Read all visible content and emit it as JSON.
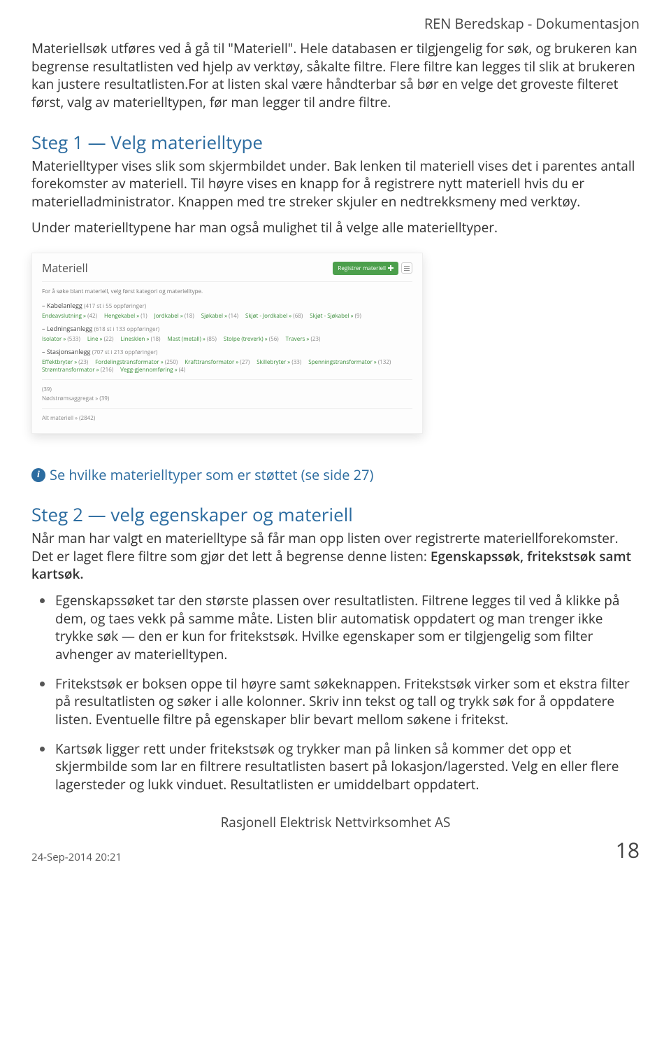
{
  "doc_header": "REN Beredskap - Dokumentasjon",
  "intro": "Materiellsøk utføres ved å gå til \"Materiell\". Hele databasen er tilgjengelig for søk, og brukeren kan begrense resultatlisten ved hjelp av verktøy, såkalte filtre. Flere filtre kan legges til slik at brukeren kan justere resultatlisten.For at listen skal være håndterbar så bør en velge det groveste filteret først, valg av materielltypen, før man legger til andre filtre.",
  "step1": {
    "title": "Steg 1 — Velg materielltype",
    "text1": "Materielltyper vises slik som skjermbildet under. Bak lenken til materiell vises det i parentes antall forekomster av materiell. Til høyre vises en knapp for å registrere nytt materiell hvis du er materielladministrator. Knappen med tre streker skjuler en nedtrekksmeny med verktøy.",
    "text2": "Under materielltypene har man også mulighet til å velge alle materielltyper."
  },
  "mock": {
    "title": "Materiell",
    "register_btn": "Registrer materiell",
    "instruction": "For å søke blant materiell, velg først kategori og materielltype.",
    "cat1": {
      "prefix": "–",
      "name": "Kabelanlegg",
      "meta": "(417 st i 55 oppføringer)",
      "subs": [
        {
          "t": "Endeavslutning »",
          "c": "(42)"
        },
        {
          "t": "Hengekabel »",
          "c": "(1)"
        },
        {
          "t": "Jordkabel »",
          "c": "(18)"
        },
        {
          "t": "Sjøkabel »",
          "c": "(14)"
        },
        {
          "t": "Skjøt - Jordkabel »",
          "c": "(68)"
        },
        {
          "t": "Skjøt - Sjøkabel »",
          "c": "(9)"
        }
      ]
    },
    "cat2": {
      "prefix": "–",
      "name": "Ledningsanlegg",
      "meta": "(618 st i 133 oppføringer)",
      "subs": [
        {
          "t": "Isolator »",
          "c": "(533)"
        },
        {
          "t": "Line »",
          "c": "(22)"
        },
        {
          "t": "Linesklen »",
          "c": "(18)"
        },
        {
          "t": "Mast (metall) »",
          "c": "(85)"
        },
        {
          "t": "Stolpe (treverk) »",
          "c": "(56)"
        },
        {
          "t": "Travers »",
          "c": "(23)"
        }
      ]
    },
    "cat3": {
      "prefix": "–",
      "name": "Stasjonsanlegg",
      "meta": "(707 st i 213 oppføringer)",
      "subs": [
        {
          "t": "Effektbryter »",
          "c": "(23)"
        },
        {
          "t": "Fordelingstransformator »",
          "c": "(250)"
        },
        {
          "t": "Krafttransformator »",
          "c": "(27)"
        },
        {
          "t": "Skillebryter »",
          "c": "(33)"
        },
        {
          "t": "Spenningstransformator »",
          "c": "(132)"
        },
        {
          "t": "Strømtransformator »",
          "c": "(216)"
        },
        {
          "t": "Vegg-gjennomføring »",
          "c": "(4)"
        }
      ]
    },
    "agg": {
      "t": "Nødstrømsaggregat »",
      "c": "(39)"
    },
    "all": {
      "t": "Alt materiell »",
      "c": "(2842)"
    }
  },
  "info_link": "Se hvilke materielltyper som er støttet (se side 27)",
  "step2": {
    "title": "Steg 2 — velg egenskaper og materiell",
    "text": "Når man har valgt en materielltype så får man opp listen over registrerte materiellforekomster. Det er laget flere filtre som gjør det lett å begrense denne listen: ",
    "bold_suffix": "Egenskapssøk, fritekstsøk samt kartsøk."
  },
  "bullets": [
    "Egenskapssøket tar den største plassen over resultatlisten. Filtrene legges til ved å klikke på dem, og taes vekk på samme måte. Listen blir automatisk oppdatert og man trenger ikke trykke søk — den er kun for fritekstsøk. Hvilke egenskaper som er tilgjengelig som filter avhenger av materielltypen.",
    "Fritekstsøk er boksen oppe til høyre samt søkeknappen. Fritekstsøk virker som et ekstra filter på resultatlisten og søker i alle kolonner. Skriv inn tekst og tall og trykk søk for å oppdatere listen. Eventuelle filtre på egenskaper blir bevart mellom søkene i fritekst.",
    "Kartsøk ligger rett under fritekstsøk og trykker man på linken så kommer det opp et skjermbilde som lar en filtrere resultatlisten basert på lokasjon/lagersted. Velg en eller flere lagersteder og lukk vinduet. Resultatlisten er umiddelbart oppdatert."
  ],
  "footer": {
    "company": "Rasjonell Elektrisk Nettvirksomhet AS",
    "date": "24-Sep-2014 20:21",
    "page": "18"
  }
}
